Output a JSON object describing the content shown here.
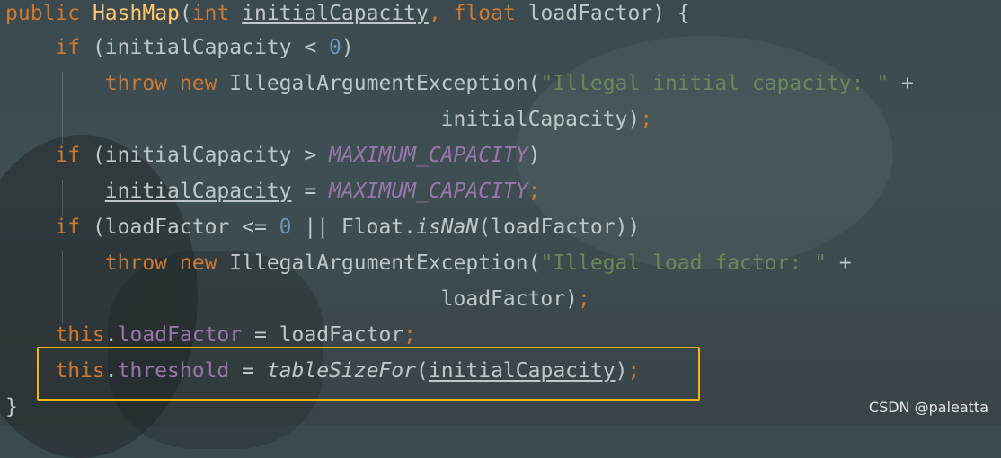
{
  "code": {
    "line1": {
      "public": "public",
      "name": "HashMap",
      "open": "(",
      "int": "int",
      "p1": "initialCapacity",
      "comma": ", ",
      "float": "float",
      "p2": "loadFactor",
      "close": ") {"
    },
    "line2": {
      "if": "if",
      "rest1": " (initialCapacity < ",
      "zero": "0",
      "rest2": ")"
    },
    "line3": {
      "throw": "throw",
      "new": "new",
      "cls": " IllegalArgumentException(",
      "str": "\"Illegal initial capacity: \"",
      "plus": " +"
    },
    "line4": {
      "arg": "initialCapacity)",
      "semi": ";"
    },
    "line5": {
      "if": "if",
      "rest1": " (initialCapacity > ",
      "const": "MAXIMUM_CAPACITY",
      "rest2": ")"
    },
    "line6": {
      "var": "initialCapacity",
      "eq": " = ",
      "const": "MAXIMUM_CAPACITY",
      "semi": ";"
    },
    "line7": {
      "if": "if",
      "rest1": " (loadFactor <= ",
      "zero": "0",
      "rest2": " || Float.",
      "method": "isNaN",
      "rest3": "(loadFactor))"
    },
    "line8": {
      "throw": "throw",
      "new": "new",
      "cls": " IllegalArgumentException(",
      "str": "\"Illegal load factor: \"",
      "plus": " +"
    },
    "line9": {
      "arg": "loadFactor)",
      "semi": ";"
    },
    "line10": {
      "this": "this",
      "dot": ".",
      "field": "loadFactor",
      "eq": " = loadFactor",
      "semi": ";"
    },
    "line11": {
      "this": "this",
      "dot": ".",
      "field": "threshold",
      "eq": " = ",
      "method": "tableSizeFor",
      "open": "(",
      "arg": "initialCapacity",
      "close": ")",
      "semi": ";"
    },
    "line12": {
      "brace": "}"
    }
  },
  "highlight": {
    "color": "#f2b70d"
  },
  "watermark": "CSDN @paleatta"
}
